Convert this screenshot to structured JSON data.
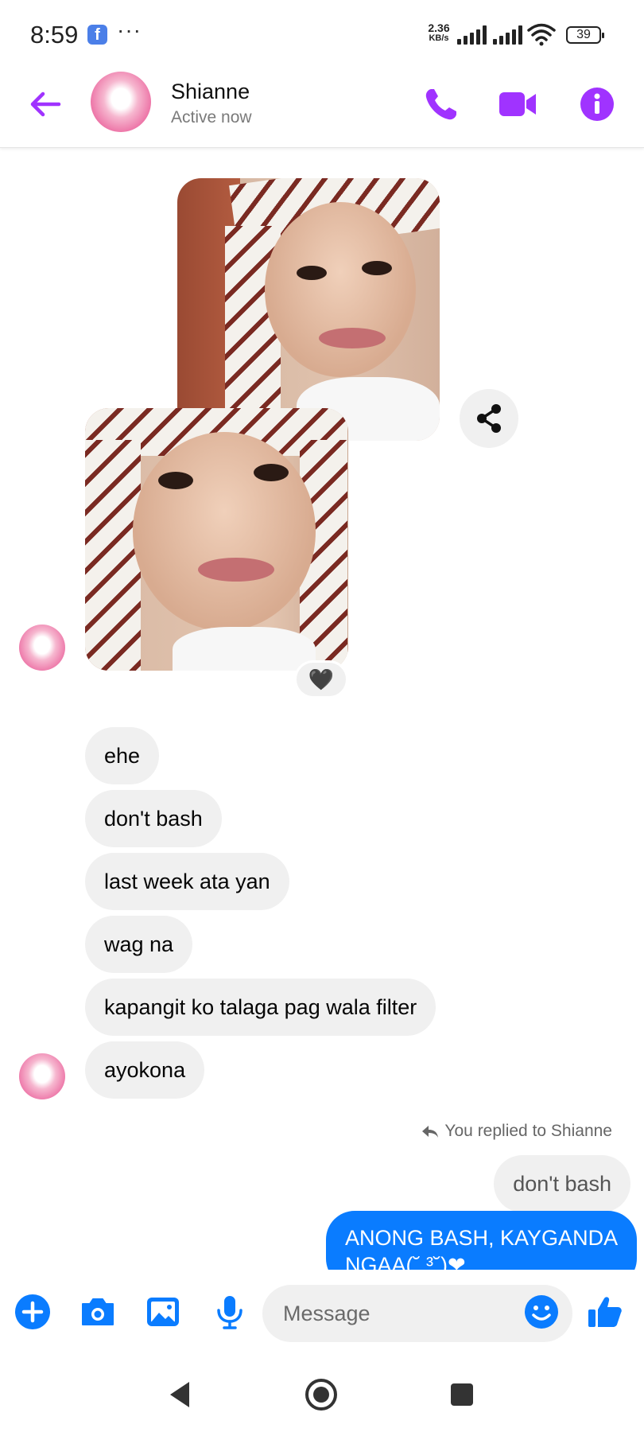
{
  "status_bar": {
    "time": "8:59",
    "app_badge": "f",
    "overflow": "···",
    "net_speed_value": "2.36",
    "net_speed_unit": "KB/s",
    "battery": "39"
  },
  "header": {
    "contact_name": "Shianne",
    "contact_status": "Active now",
    "accent_color": "#a033ff"
  },
  "chat": {
    "reaction": "🖤",
    "incoming": [
      {
        "text": "ehe"
      },
      {
        "text": "don't bash"
      },
      {
        "text": "last week ata yan"
      },
      {
        "text": "wag na"
      },
      {
        "text": "kapangit ko talaga pag wala filter"
      },
      {
        "text": "ayokona"
      }
    ],
    "reply_note": "You replied to Shianne",
    "quoted_message": "don't bash",
    "outgoing": [
      {
        "line1": "ANONG BASH, KAYGANDA",
        "line2": "NGAA(˘ ³˘)❤"
      }
    ],
    "outgoing_color": "#0a7cff"
  },
  "composer": {
    "placeholder": "Message",
    "icon_color": "#0a7cff"
  }
}
